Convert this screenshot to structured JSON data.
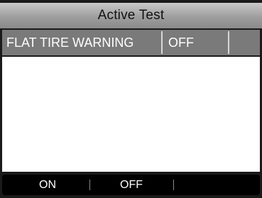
{
  "header": {
    "title": "Active Test"
  },
  "test_row": {
    "name": "FLAT TIRE WARNING",
    "value": "OFF",
    "extra": ""
  },
  "softkeys": [
    {
      "label": "ON"
    },
    {
      "label": "OFF"
    },
    {
      "label": ""
    }
  ],
  "colors": {
    "background": "#1a1a1a",
    "row": "#7a7a7a",
    "content": "#ffffff",
    "softkey_bar": "#000000"
  }
}
